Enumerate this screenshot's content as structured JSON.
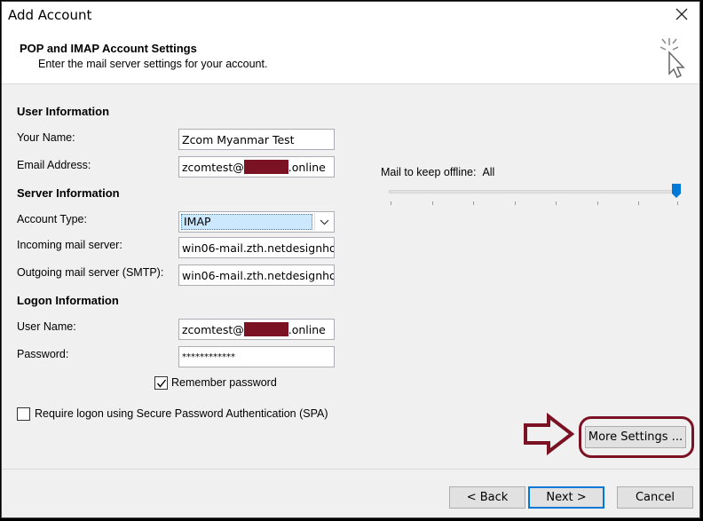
{
  "window": {
    "title": "Add Account"
  },
  "header": {
    "title": "POP and IMAP Account Settings",
    "subtitle": "Enter the mail server settings for your account."
  },
  "user_info": {
    "heading": "User Information",
    "name_label": "Your Name:",
    "name_value": "Zcom Myanmar Test",
    "email_label": "Email Address:",
    "email_prefix": "zcomtest@",
    "email_suffix": ".online"
  },
  "server_info": {
    "heading": "Server Information",
    "account_type_label": "Account Type:",
    "account_type_value": "IMAP",
    "incoming_label": "Incoming mail server:",
    "incoming_value": "win06-mail.zth.netdesignhost.",
    "outgoing_label": "Outgoing mail server (SMTP):",
    "outgoing_value": "win06-mail.zth.netdesignhost."
  },
  "logon_info": {
    "heading": "Logon Information",
    "username_label": "User Name:",
    "username_prefix": "zcomtest@",
    "username_suffix": ".online",
    "password_label": "Password:",
    "password_value": "************",
    "remember_label": "Remember password",
    "remember_checked": true,
    "spa_label": "Require logon using Secure Password Authentication (SPA)",
    "spa_checked": false
  },
  "offline": {
    "label": "Mail to keep offline:",
    "value": "All",
    "level": 1.0
  },
  "buttons": {
    "more_settings": "More Settings ...",
    "back": "< Back",
    "next": "Next >",
    "cancel": "Cancel"
  },
  "colors": {
    "highlight": "#7b1223",
    "slider_thumb": "#0078d7",
    "selection": "#cce8ff"
  }
}
